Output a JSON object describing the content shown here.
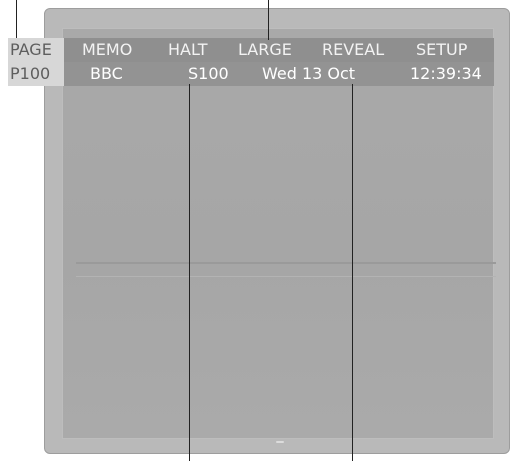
{
  "menu": {
    "items": [
      "PAGE",
      "MEMO",
      "HALT",
      "LARGE",
      "REVEAL",
      "SETUP"
    ]
  },
  "info": {
    "page": "P100",
    "channel": "BBC",
    "subpage": "S100",
    "date": "Wed 13 Oct",
    "time": "12:39:34"
  },
  "colors": {
    "bar": "#8f8f8f",
    "page_highlight": "#d7d7d7",
    "screen": "#a9a9a9",
    "callout_line": "#222222"
  }
}
